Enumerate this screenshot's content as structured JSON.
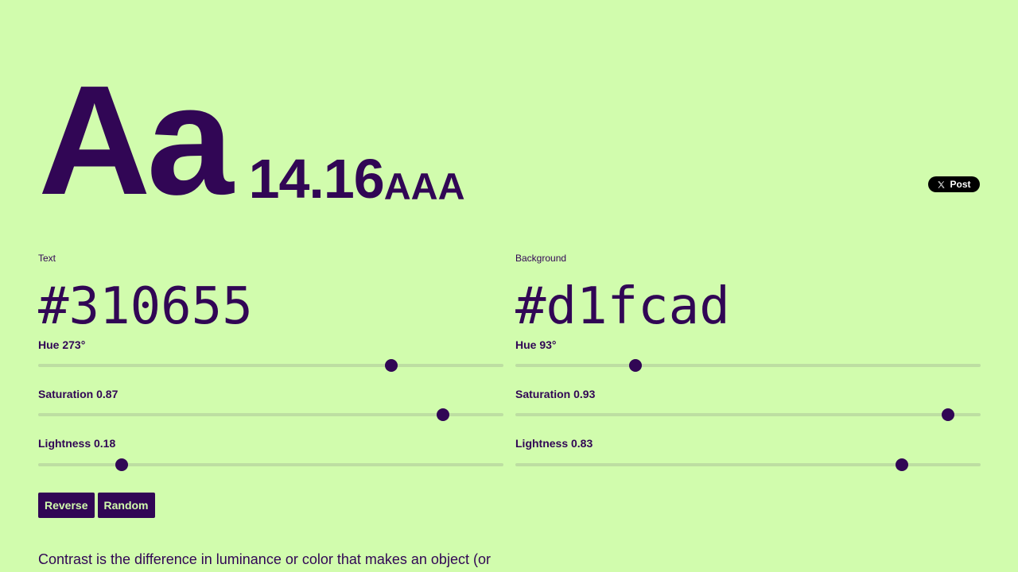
{
  "preview": {
    "sample": "Aa",
    "ratio": "14.16",
    "rating": "AAA"
  },
  "share": {
    "post_label": "Post",
    "icon": "x-logo-icon"
  },
  "text_color": {
    "label": "Text",
    "hex": "#310655",
    "hue_label": "Hue 273°",
    "hue": 273,
    "saturation_label": "Saturation 0.87",
    "saturation": 0.87,
    "lightness_label": "Lightness 0.18",
    "lightness": 0.18
  },
  "background_color": {
    "label": "Background",
    "hex": "#d1fcad",
    "hue_label": "Hue 93°",
    "hue": 93,
    "saturation_label": "Saturation 0.93",
    "saturation": 0.93,
    "lightness_label": "Lightness 0.83",
    "lightness": 0.83
  },
  "actions": {
    "reverse_label": "Reverse",
    "random_label": "Random"
  },
  "description": "Contrast is the difference in luminance or color that makes an object (or",
  "colors": {
    "text": "#310655",
    "background": "#d1fcad"
  }
}
